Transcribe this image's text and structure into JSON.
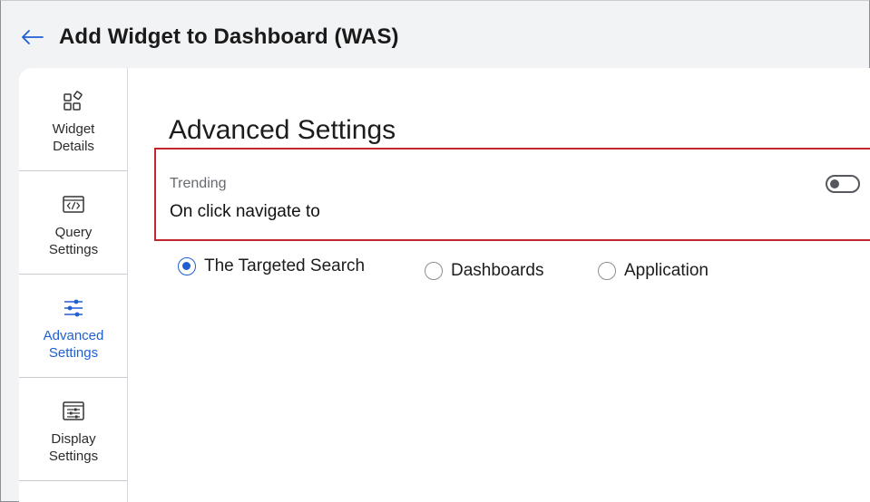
{
  "header": {
    "back_icon": "arrow-left-icon",
    "title": "Add Widget to Dashboard (WAS)"
  },
  "sidebar": {
    "items": [
      {
        "icon": "widget-shapes-icon",
        "line1": "Widget",
        "line2": "Details",
        "active": false
      },
      {
        "icon": "code-window-icon",
        "line1": "Query",
        "line2": "Settings",
        "active": false
      },
      {
        "icon": "sliders-icon",
        "line1": "Advanced",
        "line2": "Settings",
        "active": true
      },
      {
        "icon": "display-settings-icon",
        "line1": "Display",
        "line2": "Settings",
        "active": false
      }
    ]
  },
  "main": {
    "section_title": "Advanced Settings",
    "trending": {
      "label": "Trending",
      "value": "On click navigate to",
      "toggle_on": false
    },
    "navigate_options": [
      {
        "label": "The Targeted Search",
        "selected": true
      },
      {
        "label": "Dashboards",
        "selected": false
      },
      {
        "label": "Application",
        "selected": false
      }
    ]
  },
  "colors": {
    "accent": "#1f5fd1",
    "highlight_border": "#c0262d",
    "background": "#f2f3f5"
  }
}
